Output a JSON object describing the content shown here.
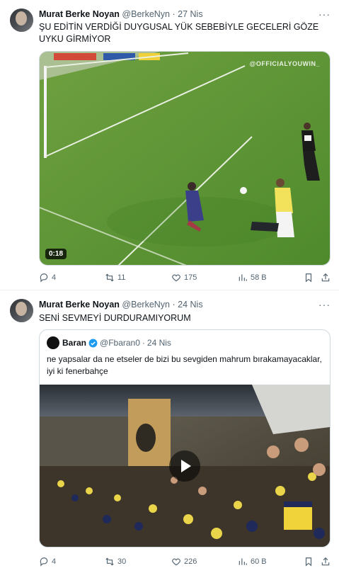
{
  "tweets": [
    {
      "author": {
        "name": "Murat Berke Noyan",
        "handle": "@BerkeNyn"
      },
      "separator": "·",
      "time": "27 Nis",
      "text": "ŞU EDİTİN VERDİĞİ DUYGUSAL YÜK SEBEBİYLE GECELERİ GÖZE UYKU GİRMİYOR",
      "media": {
        "duration": "0:18",
        "watermark": "@OFFICIALYOUWIN_",
        "icon": "video-thumbnail"
      },
      "stats": {
        "replies": "4",
        "reposts": "11",
        "likes": "175",
        "views": "58 B"
      }
    },
    {
      "author": {
        "name": "Murat Berke Noyan",
        "handle": "@BerkeNyn"
      },
      "separator": "·",
      "time": "24 Nis",
      "text": "SENİ SEVMEYİ DURDURAMIYORUM",
      "quote": {
        "author": {
          "name": "Baran",
          "handle": "@Fbaran0"
        },
        "separator": "·",
        "time": "24 Nis",
        "text": "ne yapsalar da ne etseler de bizi bu sevgiden mahrum bırakamayacaklar, iyi ki fenerbahçe"
      },
      "stats": {
        "replies": "4",
        "reposts": "30",
        "likes": "226",
        "views": "60 B"
      }
    }
  ],
  "colors": {
    "text": "#0f1419",
    "muted": "#536471",
    "verified": "#1d9bf0",
    "border": "#cfd9de",
    "divider": "#eff3f4"
  }
}
